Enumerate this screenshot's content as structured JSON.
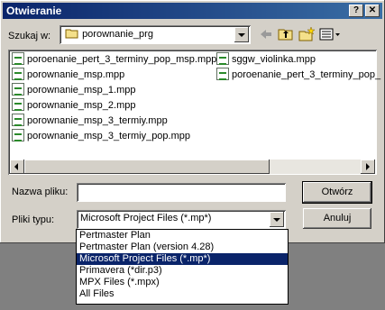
{
  "window": {
    "title": "Otwieranie",
    "help_btn": "?",
    "close_btn": "✕"
  },
  "lookin": {
    "label": "Szukaj w:",
    "value": "porownanie_prg"
  },
  "toolbar": {
    "icons": [
      "back-arrow-icon",
      "up-folder-icon",
      "new-folder-icon",
      "view-menu-icon"
    ]
  },
  "files_col1": [
    "poroenanie_pert_3_terminy_pop_msp.mpp",
    "porownanie_msp.mpp",
    "porownanie_msp_1.mpp",
    "porownanie_msp_2.mpp",
    "porownanie_msp_3_termiy.mpp",
    "porownanie_msp_3_termiy_pop.mpp"
  ],
  "files_col2": [
    "sggw_violinka.mpp",
    "poroenanie_pert_3_terminy_pop_"
  ],
  "filename": {
    "label": "Nazwa pliku:",
    "value": ""
  },
  "filetype": {
    "label": "Pliki typu:",
    "value": "Microsoft Project Files (*.mp*)"
  },
  "buttons": {
    "open": "Otwórz",
    "cancel": "Anuluj"
  },
  "filetype_options": [
    "Pertmaster Plan",
    "Pertmaster Plan (version 4.28)",
    "Microsoft Project Files (*.mp*)",
    "Primavera (*dir.p3)",
    "MPX Files (*.mpx)",
    "All Files"
  ],
  "selected_option_index": 2
}
